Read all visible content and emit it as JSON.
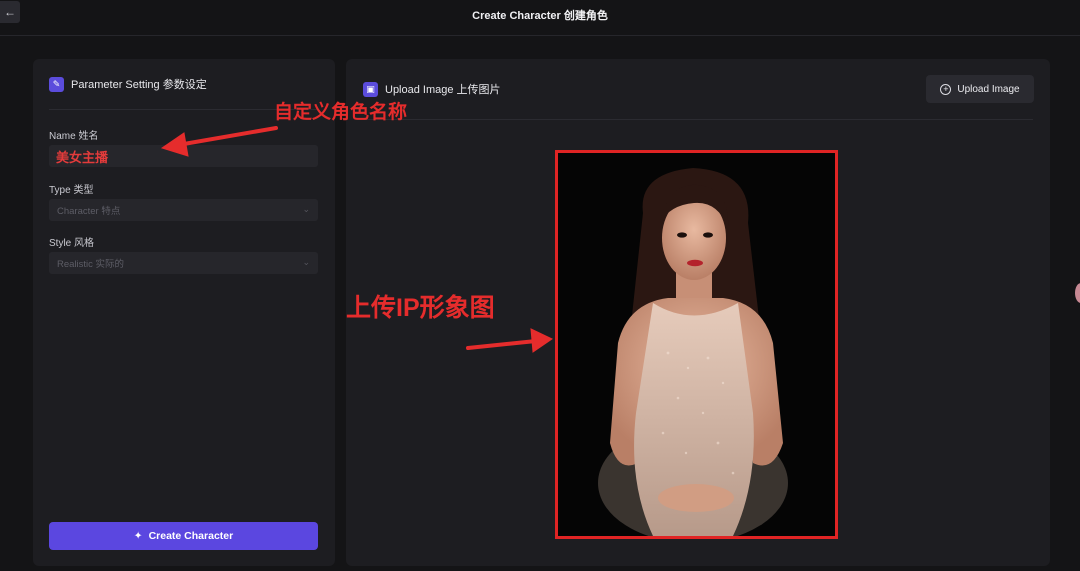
{
  "header": {
    "title": "Create Character 创建角色",
    "back_icon": "arrow-left-icon"
  },
  "left_panel": {
    "title": "Parameter Setting 参数设定",
    "icon": "edit-icon",
    "fields": {
      "name": {
        "label": "Name 姓名",
        "value": "美女主播"
      },
      "type": {
        "label": "Type 类型",
        "placeholder": "Character 特点"
      },
      "style": {
        "label": "Style 风格",
        "placeholder": "Realistic 实际的"
      }
    },
    "create_button": {
      "label": "Create Character",
      "icon": "sparkle-icon"
    }
  },
  "right_panel": {
    "title": "Upload Image 上传图片",
    "icon": "image-icon",
    "upload_button": {
      "label": "Upload Image",
      "icon": "plus-circle-icon"
    }
  },
  "annotations": {
    "name_note": "自定义角色名称",
    "image_note": "上传IP形象图"
  },
  "colors": {
    "accent": "#5b47e0",
    "annotation": "#e52c2c",
    "background": "#141416",
    "panel": "#1d1d21"
  }
}
